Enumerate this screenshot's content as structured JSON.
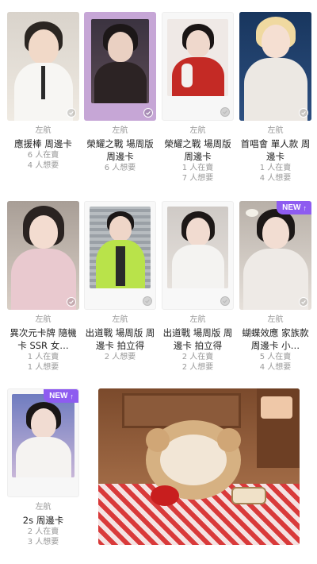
{
  "cards": [
    {
      "group": "左航",
      "title": "應援棒 周邊卡",
      "stats": [
        "6 人在賣",
        "4 人想要"
      ]
    },
    {
      "group": "左航",
      "title": "榮耀之戰 場周版 周邊卡",
      "stats": [
        "6 人想要"
      ]
    },
    {
      "group": "左航",
      "title": "榮耀之戰 場周版 周邊卡",
      "stats": [
        "1 人在賣",
        "7 人想要"
      ]
    },
    {
      "group": "左航",
      "title": "首唱會 單人款 周邊卡",
      "stats": [
        "1 人在賣",
        "4 人想要"
      ]
    },
    {
      "group": "左航",
      "title": "異次元卡牌 隨機卡 SSR 女…",
      "stats": [
        "1 人在賣",
        "1 人想要"
      ]
    },
    {
      "group": "左航",
      "title": "出道戰 場周版 周邊卡 拍立得",
      "stats": [
        "2 人想要"
      ]
    },
    {
      "group": "左航",
      "title": "出道戰 場周版 周邊卡 拍立得",
      "stats": [
        "2 人在賣",
        "2 人想要"
      ]
    },
    {
      "group": "左航",
      "title": "蝴蝶效應 家族款 周邊卡 小…",
      "stats": [
        "5 人在賣",
        "4 人想要"
      ],
      "badge": "NEW"
    },
    {
      "group": "左航",
      "title": "2s 周邊卡",
      "stats": [
        "2 人在賣",
        "3 人想要"
      ],
      "badge": "NEW"
    }
  ],
  "colors": {
    "accent": "#8e5cf0",
    "muted": "#9a9a9a"
  },
  "icons": {
    "check": "check-circle-icon",
    "new_arrow": "arrow-up-icon"
  }
}
